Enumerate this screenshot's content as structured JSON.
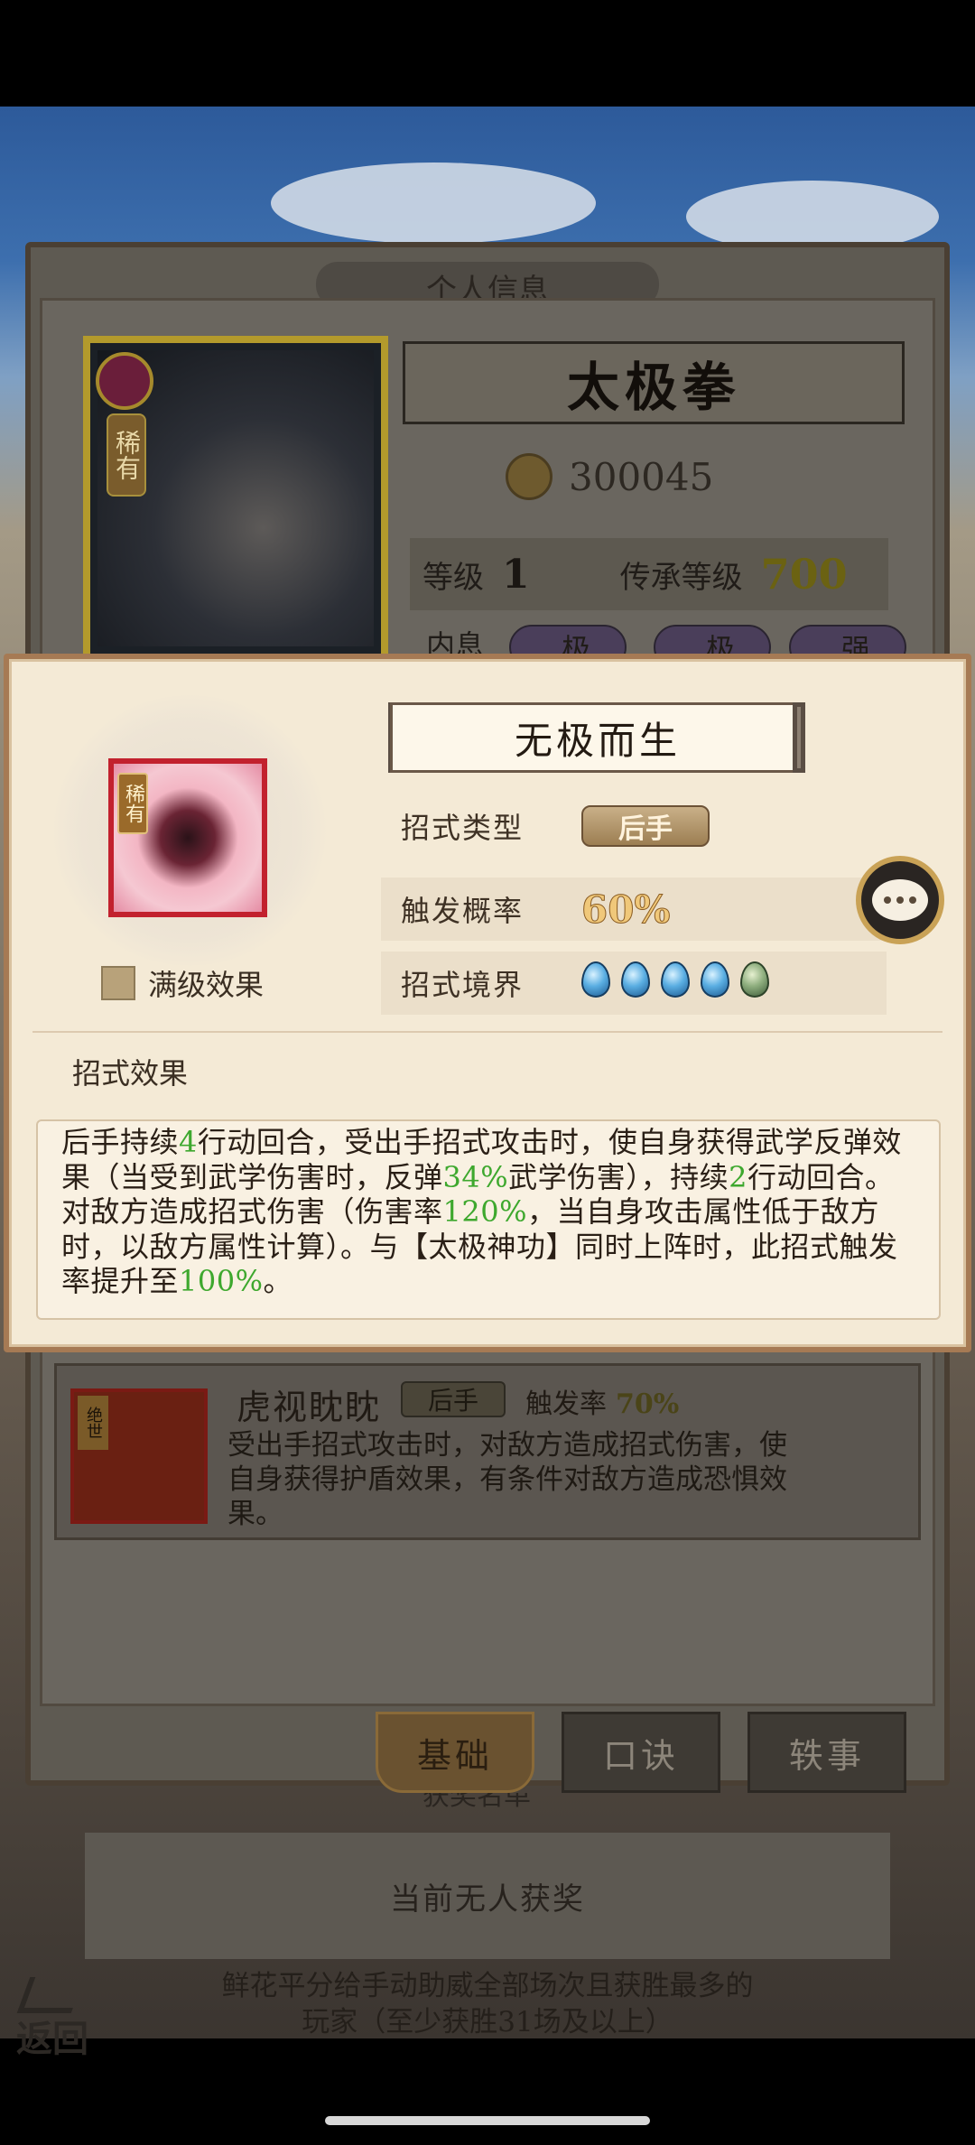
{
  "back_panel": {
    "tab_title_partial": "个人信息",
    "hero_rarity": "稀有",
    "martial_name": "太极拳",
    "power": "300045",
    "level_label": "等级",
    "level_value": "1",
    "inherit_label": "传承等级",
    "inherit_value": "700",
    "inner_label": "内息",
    "inner_pills": [
      "极",
      "极",
      "强"
    ]
  },
  "popup": {
    "skill_rarity": "稀有",
    "skill_name": "无极而生",
    "max_level_label": "满级效果",
    "type_label": "招式类型",
    "type_value": "后手",
    "rate_label": "触发概率",
    "rate_value": "60%",
    "realm_label": "招式境界",
    "realm_drops": 5,
    "realm_full": 4,
    "effect_title": "招式效果",
    "effect": {
      "p1": "后手持续",
      "n1": "4",
      "p2": "行动回合，受出手招式攻击时，使自身获得武学反弹效果（当受到武学伤害时，反弹",
      "n2": "34%",
      "p3": "武学伤害），持续",
      "n3": "2",
      "p4": "行动回合。对敌方造成招式伤害（伤害率",
      "n4": "120%",
      "p5": "，当自身攻击属性低于敌方时，以敌方属性计算）。与【太极神功】同时上阵时，此招式触发率提升至",
      "n5": "100%",
      "p6": "。"
    }
  },
  "lower": {
    "move_rarity": "绝世",
    "move_name": "虎视眈眈",
    "move_type": "后手",
    "move_rate_label": "触发率",
    "move_rate_value": "70%",
    "move_desc": "受出手招式攻击时，对敌方造成招式伤害，使自身获得护盾效果，有条件对敌方造成恐惧效果。",
    "tabs": [
      "基础",
      "口诀",
      "轶事"
    ],
    "award_title_partial": "获奖名单",
    "award_empty": "当前无人获奖",
    "note": "鲜花平分给手动助威全部场次且获胜最多的玩家（至少获胜31场及以上）",
    "back_label": "返回"
  },
  "colors": {
    "popup_bg": "#f4ead6",
    "highlight_green": "#3ea82e",
    "frame_brown": "#a67a54",
    "rate_gold": "#f0c87a"
  },
  "icons": [
    "chat-icon",
    "realm-drop-icon",
    "back-arrow-icon",
    "coin-icon"
  ]
}
